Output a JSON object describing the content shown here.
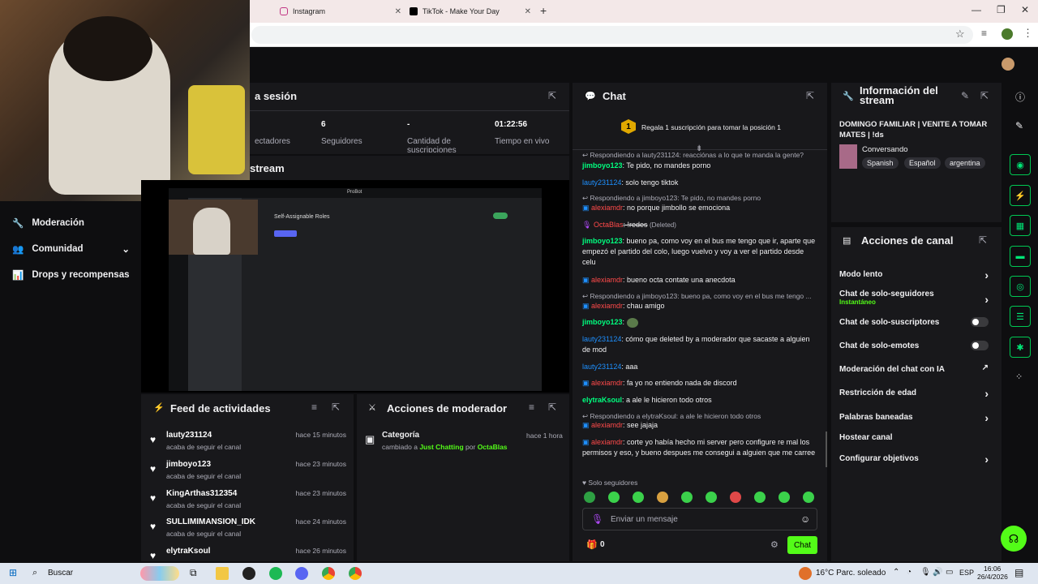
{
  "browser": {
    "tabs": [
      {
        "label": "Instagram"
      },
      {
        "label": "TikTok - Make Your Day"
      }
    ],
    "new_tab": "+"
  },
  "stats": {
    "title_partial": "a sesión",
    "viewers_label": "ectadores",
    "followers_value": "6",
    "followers_label": "Seguidores",
    "subs_value": "-",
    "subs_label": "Cantidad de suscripciones",
    "live_value": "01:22:56",
    "live_label": "Tiempo en vivo"
  },
  "preview": {
    "title_partial": "stream",
    "discord_title": "ProBot",
    "discord_setting": "Self-Assignable Roles"
  },
  "sidebar": {
    "items": [
      {
        "label": "Moderación"
      },
      {
        "label": "Comunidad"
      },
      {
        "label": "Drops y recompensas"
      }
    ]
  },
  "chat": {
    "title": "Chat",
    "gift_banner": "Regala 1 suscripción para tomar la posición 1",
    "gift_rank": "1",
    "messages": [
      {
        "reply": "Respondiendo a lauty231124: reacciónas a lo que te manda la gente?"
      },
      {
        "user": "jimboyo123",
        "text": ": Te pido, no mandes porno"
      },
      {
        "user": "lauty231124",
        "text": ": solo tengo tiktok"
      },
      {
        "reply": "Respondiendo a jimboyo123: Te pido, no mandes porno"
      },
      {
        "user": "alexiamdr",
        "text": ": no porque jimbollo se emociona"
      },
      {
        "user": "OctaBlas",
        "text": ": !redes",
        "tag": "(Deleted)"
      },
      {
        "user": "jimboyo123",
        "text": ": bueno pa, como voy en el bus me tengo que ir, aparte que empezó el partido del colo, luego vuelvo y voy a ver el partido desde celu"
      },
      {
        "user": "alexiamdr",
        "text": ": bueno octa contate una anecdota"
      },
      {
        "reply": "Respondiendo a jimboyo123: bueno pa, como voy en el bus me tengo ..."
      },
      {
        "user": "alexiamdr",
        "text": ": chau amigo"
      },
      {
        "user": "jimboyo123",
        "text": ":"
      },
      {
        "user": "lauty231124",
        "text": ": cómo que deleted by a moderador que sacaste a alguien de mod"
      },
      {
        "user": "lauty231124",
        "text": ": aaa"
      },
      {
        "user": "alexiamdr",
        "text": ": fa yo no entiendo nada de discord"
      },
      {
        "user": "elytraKsoul",
        "text": ": a ale le hicieron todo otros"
      },
      {
        "reply": "Respondiendo a elytraKsoul: a ale le hicieron todo otros"
      },
      {
        "user": "alexiamdr",
        "text": ": see jajaja"
      },
      {
        "user": "alexiamdr",
        "text": ": corte yo había hecho mi server pero configure re mal los permisos y eso, y bueno despues me consegui a alguien que me carree"
      }
    ],
    "followers_only": "Solo seguidores",
    "input_placeholder": "Enviar un mensaje",
    "points": "0",
    "send_label": "Chat"
  },
  "feed": {
    "title": "Feed de actividades",
    "items": [
      {
        "name": "lauty231124",
        "sub": "acaba de seguir el canal",
        "time": "hace 15 minutos"
      },
      {
        "name": "jimboyo123",
        "sub": "acaba de seguir el canal",
        "time": "hace 23 minutos"
      },
      {
        "name": "KingArthas312354",
        "sub": "acaba de seguir el canal",
        "time": "hace 23 minutos"
      },
      {
        "name": "SULLIMIMANSION_IDK",
        "sub": "acaba de seguir el canal",
        "time": "hace 24 minutos"
      },
      {
        "name": "elytraKsoul",
        "sub": "",
        "time": "hace 26 minutos"
      }
    ]
  },
  "modactions": {
    "title": "Acciones de moderador",
    "item_title": "Categoría",
    "item_prefix": "cambiado a",
    "item_category": "Just Chatting",
    "item_by": "por",
    "item_user": "OctaBlas",
    "item_time": "hace 1 hora"
  },
  "streaminfo": {
    "title": "Información del stream",
    "stream_title": "DOMINGO FAMILIAR | VENITE A TOMAR MATES | !ds",
    "category": "Conversando",
    "tags": [
      "Spanish",
      "Español",
      "argentina"
    ]
  },
  "channel_actions": {
    "title": "Acciones de canal",
    "items": [
      {
        "label": "Modo lento",
        "control": "chevron"
      },
      {
        "label": "Chat de solo-seguidores",
        "sub": "Instantáneo",
        "control": "chevron"
      },
      {
        "label": "Chat de solo-suscriptores",
        "control": "toggle"
      },
      {
        "label": "Chat de solo-emotes",
        "control": "toggle"
      },
      {
        "label": "Moderación del chat con IA",
        "control": "external"
      },
      {
        "label": "Restricción de edad",
        "control": "chevron"
      },
      {
        "label": "Palabras baneadas",
        "control": "chevron"
      },
      {
        "label": "Hostear canal",
        "control": "none"
      },
      {
        "label": "Configurar objetivos",
        "control": "chevron"
      }
    ]
  },
  "taskbar": {
    "search": "Buscar",
    "weather": "16°C  Parc. soleado",
    "lang": "ESP",
    "time": "16:06",
    "date": "26/4/2026"
  },
  "colors": {
    "accent": "#53fc18",
    "panel": "#18181b",
    "background": "#0e0e10"
  }
}
